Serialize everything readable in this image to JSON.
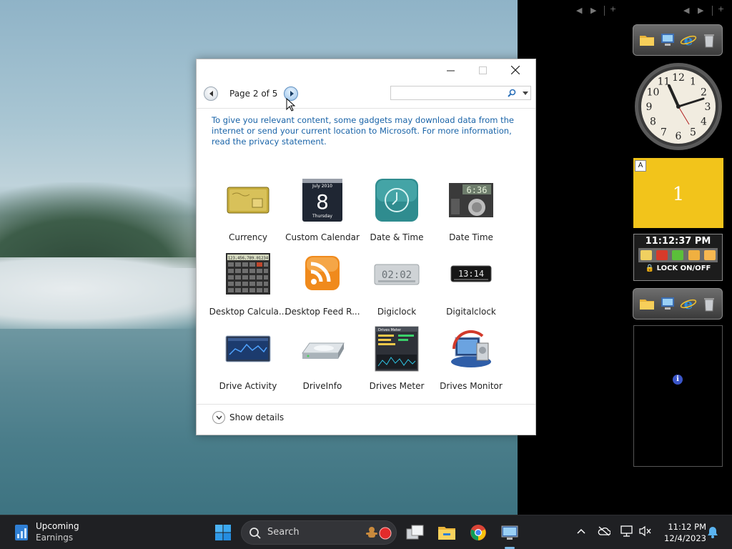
{
  "dialog": {
    "page_label": "Page 2 of 5",
    "search_placeholder": "",
    "privacy_text": "To give you relevant content, some gadgets may download data from the internet or send your current location to Microsoft. For more information, read the privacy statement.",
    "show_details": "Show details",
    "gadgets": [
      {
        "name": "Currency",
        "icon": "currency-icon"
      },
      {
        "name": "Custom Calendar",
        "icon": "calendar-icon",
        "month": "July 2010",
        "day": "8",
        "weekday": "Thursday"
      },
      {
        "name": "Date & Time",
        "icon": "clock-icon"
      },
      {
        "name": "Date Time",
        "icon": "digital-meter-icon",
        "display": "6:36"
      },
      {
        "name": "Desktop Calcula...",
        "icon": "calculator-icon",
        "display": "123,456,789.01234"
      },
      {
        "name": "Desktop Feed R...",
        "icon": "rss-feed-icon"
      },
      {
        "name": "Digiclock",
        "icon": "digiclock-icon",
        "display": "02:02"
      },
      {
        "name": "Digitalclock",
        "icon": "digitalclock-icon",
        "display": "13:14"
      },
      {
        "name": "Drive Activity",
        "icon": "drive-activity-icon"
      },
      {
        "name": "DriveInfo",
        "icon": "hard-drive-icon"
      },
      {
        "name": "Drives Meter",
        "icon": "drives-meter-icon",
        "title": "Drives Meter"
      },
      {
        "name": "Drives Monitor",
        "icon": "drives-monitor-icon"
      }
    ]
  },
  "sidebar": {
    "calendar_letter": "A",
    "calendar_day": "1",
    "lock_time": "11:12:37 PM",
    "lock_label": "LOCK ON/OFF",
    "clock_numbers": [
      "12",
      "1",
      "2",
      "3",
      "4",
      "5",
      "6",
      "7",
      "8",
      "9",
      "10",
      "11"
    ]
  },
  "taskbar": {
    "news_title": "Upcoming",
    "news_subtitle": "Earnings",
    "search_label": "Search",
    "time": "11:12 PM",
    "date": "12/4/2023"
  },
  "colors": {
    "link": "#1a64a8",
    "calendar_bg": "#f2c41b",
    "taskbar_bg": "#1f2023"
  }
}
